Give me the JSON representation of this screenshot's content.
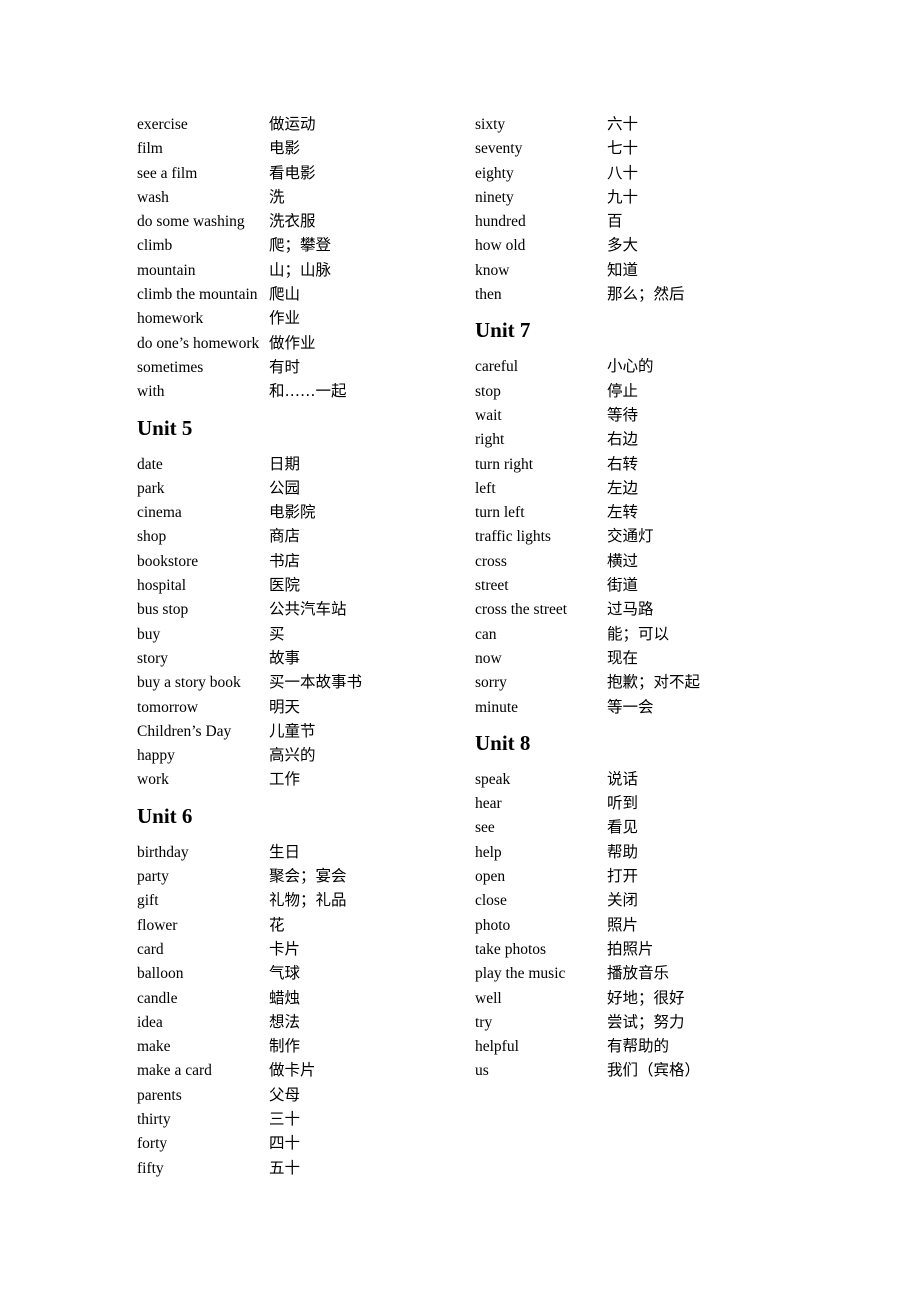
{
  "document": {
    "type": "vocabulary-list",
    "languages": [
      "English",
      "Chinese"
    ]
  },
  "columns": [
    {
      "id": "left-column",
      "blocks": [
        {
          "type": "entries",
          "entries": [
            {
              "term": "exercise",
              "gloss": "做运动"
            },
            {
              "term": "film",
              "gloss": "电影"
            },
            {
              "term": "see a film",
              "gloss": "看电影"
            },
            {
              "term": "wash",
              "gloss": "洗"
            },
            {
              "term": "do some washing",
              "gloss": "洗衣服"
            },
            {
              "term": "climb",
              "gloss": "爬；攀登"
            },
            {
              "term": "mountain",
              "gloss": "山；山脉"
            },
            {
              "term": "climb the mountain",
              "gloss": "爬山"
            },
            {
              "term": "homework",
              "gloss": "作业"
            },
            {
              "term": "do one’s homework",
              "gloss": "做作业"
            },
            {
              "term": "sometimes",
              "gloss": "有时"
            },
            {
              "term": "with",
              "gloss": "和……一起"
            }
          ]
        },
        {
          "type": "heading",
          "title": "Unit 5"
        },
        {
          "type": "entries",
          "entries": [
            {
              "term": "date",
              "gloss": "日期"
            },
            {
              "term": "park",
              "gloss": "公园"
            },
            {
              "term": "cinema",
              "gloss": "电影院"
            },
            {
              "term": "shop",
              "gloss": "商店"
            },
            {
              "term": "bookstore",
              "gloss": "书店"
            },
            {
              "term": "hospital",
              "gloss": "医院"
            },
            {
              "term": "bus stop",
              "gloss": "公共汽车站"
            },
            {
              "term": "buy",
              "gloss": "买"
            },
            {
              "term": "story",
              "gloss": "故事"
            },
            {
              "term": "buy a story book",
              "gloss": "买一本故事书"
            },
            {
              "term": "tomorrow",
              "gloss": "明天"
            },
            {
              "term": "Children’s Day",
              "gloss": "儿童节"
            },
            {
              "term": "happy",
              "gloss": "高兴的"
            },
            {
              "term": "work",
              "gloss": "工作"
            }
          ]
        },
        {
          "type": "heading",
          "title": "Unit 6"
        },
        {
          "type": "entries",
          "entries": [
            {
              "term": "birthday",
              "gloss": "生日"
            },
            {
              "term": "party",
              "gloss": "聚会；宴会"
            },
            {
              "term": "gift",
              "gloss": "礼物；礼品"
            },
            {
              "term": "flower",
              "gloss": "花"
            },
            {
              "term": "card",
              "gloss": "卡片"
            },
            {
              "term": "balloon",
              "gloss": "气球"
            },
            {
              "term": "candle",
              "gloss": "蜡烛"
            },
            {
              "term": "idea",
              "gloss": "想法"
            },
            {
              "term": "make",
              "gloss": "制作"
            },
            {
              "term": "make a card",
              "gloss": "做卡片"
            },
            {
              "term": "parents",
              "gloss": "父母"
            },
            {
              "term": "thirty",
              "gloss": "三十"
            },
            {
              "term": "forty",
              "gloss": "四十"
            },
            {
              "term": "fifty",
              "gloss": "五十"
            }
          ]
        }
      ]
    },
    {
      "id": "right-column",
      "blocks": [
        {
          "type": "entries",
          "entries": [
            {
              "term": "sixty",
              "gloss": "六十"
            },
            {
              "term": "seventy",
              "gloss": "七十"
            },
            {
              "term": "eighty",
              "gloss": "八十"
            },
            {
              "term": "ninety",
              "gloss": "九十"
            },
            {
              "term": "hundred",
              "gloss": "百"
            },
            {
              "term": "how old",
              "gloss": "多大"
            },
            {
              "term": "know",
              "gloss": "知道"
            },
            {
              "term": "then",
              "gloss": "那么；然后"
            }
          ]
        },
        {
          "type": "heading",
          "title": "Unit 7"
        },
        {
          "type": "entries",
          "entries": [
            {
              "term": "careful",
              "gloss": "小心的"
            },
            {
              "term": "stop",
              "gloss": "停止"
            },
            {
              "term": "wait",
              "gloss": "等待"
            },
            {
              "term": "right",
              "gloss": "右边"
            },
            {
              "term": "turn right",
              "gloss": "右转"
            },
            {
              "term": "left",
              "gloss": "左边"
            },
            {
              "term": "turn left",
              "gloss": "左转"
            },
            {
              "term": "traffic lights",
              "gloss": "交通灯"
            },
            {
              "term": "cross",
              "gloss": "横过"
            },
            {
              "term": "street",
              "gloss": "街道"
            },
            {
              "term": "cross the street",
              "gloss": "过马路"
            },
            {
              "term": "can",
              "gloss": "能；可以"
            },
            {
              "term": "now",
              "gloss": "现在"
            },
            {
              "term": "sorry",
              "gloss": "抱歉；对不起"
            },
            {
              "term": "minute",
              "gloss": "等一会"
            }
          ]
        },
        {
          "type": "heading",
          "title": "Unit 8"
        },
        {
          "type": "entries",
          "entries": [
            {
              "term": "speak",
              "gloss": "说话"
            },
            {
              "term": "hear",
              "gloss": "听到"
            },
            {
              "term": "see",
              "gloss": "看见"
            },
            {
              "term": "help",
              "gloss": "帮助"
            },
            {
              "term": "open",
              "gloss": "打开"
            },
            {
              "term": "close",
              "gloss": "关闭"
            },
            {
              "term": "photo",
              "gloss": "照片"
            },
            {
              "term": "take photos",
              "gloss": "拍照片"
            },
            {
              "term": "play the music",
              "gloss": "播放音乐"
            },
            {
              "term": "well",
              "gloss": "好地；很好"
            },
            {
              "term": "try",
              "gloss": "尝试；努力"
            },
            {
              "term": "helpful",
              "gloss": "有帮助的"
            },
            {
              "term": "us",
              "gloss": "我们（宾格）"
            }
          ]
        }
      ]
    }
  ]
}
